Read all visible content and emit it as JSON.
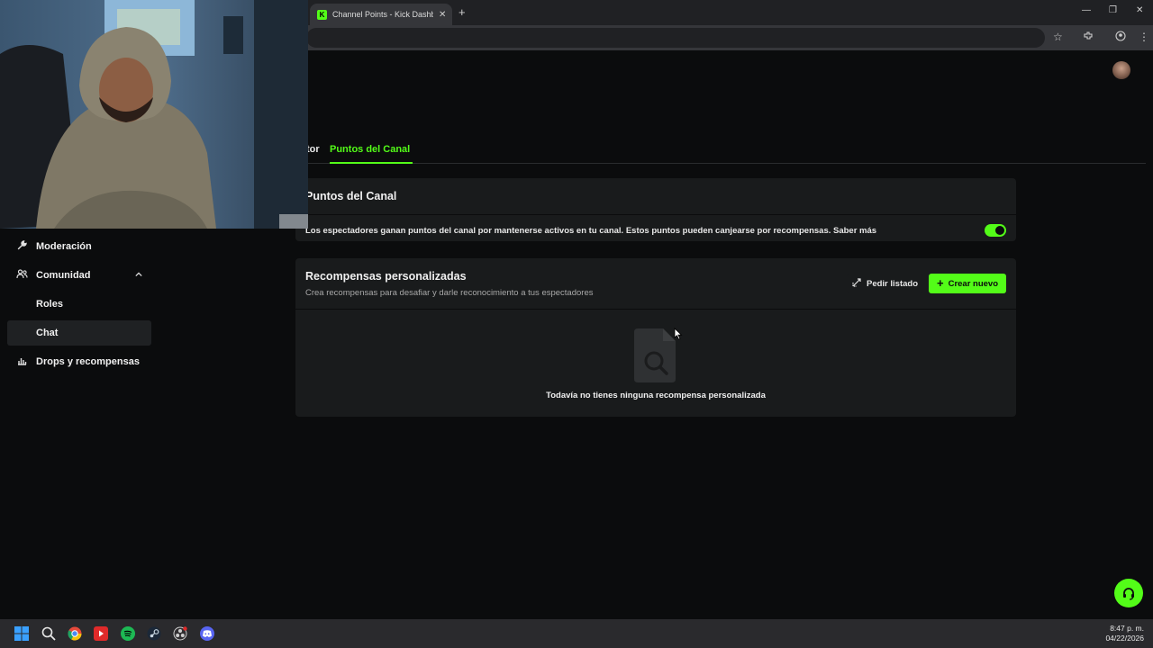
{
  "browser": {
    "tab_title": "Channel Points - Kick Dashboard",
    "tab_favicon": "K",
    "tab_close": "✕",
    "new_tab": "+",
    "window_controls": {
      "minimize": "—",
      "maximize": "❐",
      "close": "✕"
    }
  },
  "tabs": [
    {
      "label": "tor",
      "active": false
    },
    {
      "label": "Puntos del Canal",
      "active": true
    }
  ],
  "channel_points": {
    "title": "Puntos del Canal",
    "description": "Los espectadores ganan puntos del canal por mantenerse activos en tu canal. Estos puntos pueden canjearse por recompensas. Saber más",
    "enabled": true
  },
  "rewards": {
    "title": "Recompensas personalizadas",
    "subtitle": "Crea recompensas para desafiar y darle reconocimiento a tus espectadores",
    "request_list_button": "Pedir listado",
    "create_button": "Crear nuevo",
    "empty_message": "Todavía no tienes ninguna recompensa personalizada"
  },
  "sidebar": {
    "items": [
      {
        "label": "Moderación",
        "icon": "wrench-icon"
      },
      {
        "label": "Comunidad",
        "icon": "people-icon",
        "expanded": true
      },
      {
        "label": "Roles",
        "icon": ""
      },
      {
        "label": "Chat",
        "icon": "",
        "active": true
      },
      {
        "label": "Drops y recompensas",
        "icon": "gift-icon"
      }
    ]
  },
  "taskbar": {
    "time": "8:47 p. m.",
    "date": "04/22/2026"
  },
  "colors": {
    "accent": "#53fc18",
    "background": "#0b0c0d",
    "card": "#191b1c"
  }
}
